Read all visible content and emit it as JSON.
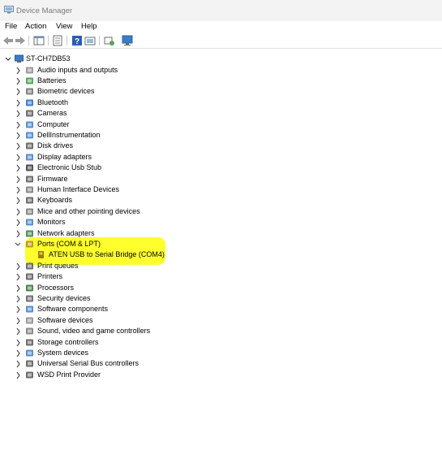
{
  "window": {
    "title": "Device Manager",
    "icon": "device-manager-icon"
  },
  "menu": [
    "File",
    "Action",
    "View",
    "Help"
  ],
  "toolbar": {
    "buttons": [
      "back-icon",
      "forward-icon",
      "show-hide-console-tree-icon",
      "properties-icon",
      "help-icon",
      "update-driver-icon",
      "scan-hardware-icon",
      "monitor-icon"
    ]
  },
  "tree": {
    "root": "ST-CH7DB53",
    "categories": [
      "Audio inputs and outputs",
      "Batteries",
      "Biometric devices",
      "Bluetooth",
      "Cameras",
      "Computer",
      "DellInstrumentation",
      "Disk drives",
      "Display adapters",
      "Electronic Usb Stub",
      "Firmware",
      "Human Interface Devices",
      "Keyboards",
      "Mice and other pointing devices",
      "Monitors",
      "Network adapters",
      "Ports (COM & LPT)",
      "Print queues",
      "Printers",
      "Processors",
      "Security devices",
      "Software components",
      "Software devices",
      "Sound, video and game controllers",
      "Storage controllers",
      "System devices",
      "Universal Serial Bus controllers",
      "WSD Print Provider"
    ],
    "expanded_child": "ATEN USB to Serial Bridge (COM4)",
    "highlight_color": "#ffff2e"
  }
}
